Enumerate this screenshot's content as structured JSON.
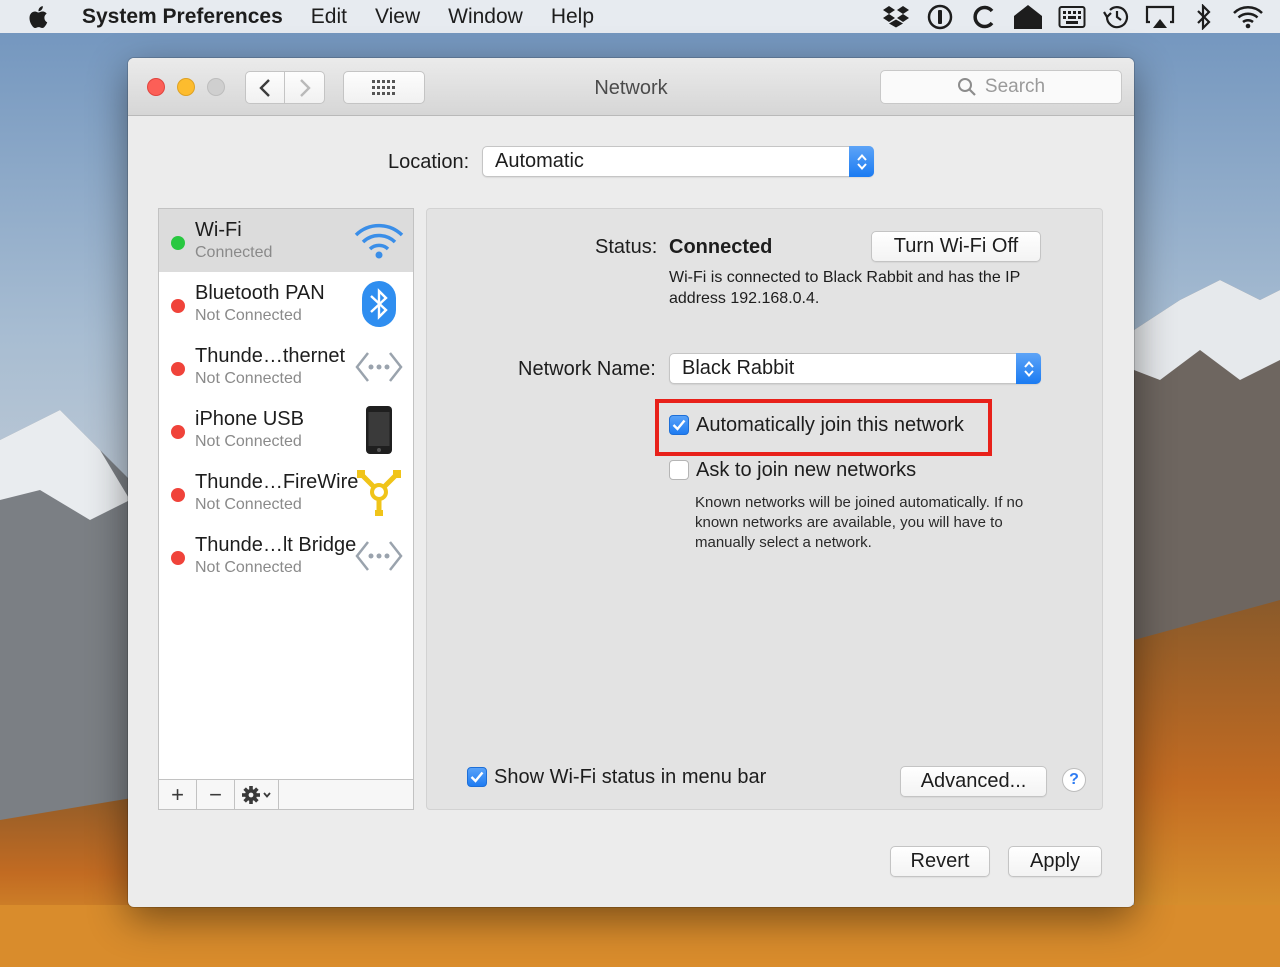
{
  "menubar": {
    "app_name": "System Preferences",
    "menus": [
      "Edit",
      "View",
      "Window",
      "Help"
    ],
    "status_icons": [
      "dropbox-icon",
      "1password-icon",
      "c-app-icon",
      "home-icon",
      "keyboard-viewer-icon",
      "time-machine-icon",
      "airplay-icon",
      "bluetooth-icon",
      "wifi-icon"
    ]
  },
  "window": {
    "title": "Network",
    "search_placeholder": "Search"
  },
  "location": {
    "label": "Location:",
    "value": "Automatic"
  },
  "services": [
    {
      "name": "Wi-Fi",
      "status": "Connected",
      "state_color": "#28c840",
      "icon": "wifi-icon",
      "selected": true
    },
    {
      "name": "Bluetooth PAN",
      "status": "Not Connected",
      "state_color": "#f0433a",
      "icon": "bluetooth-icon",
      "selected": false
    },
    {
      "name": "Thunde…thernet",
      "status": "Not Connected",
      "state_color": "#f0433a",
      "icon": "ethernet-icon",
      "selected": false
    },
    {
      "name": "iPhone USB",
      "status": "Not Connected",
      "state_color": "#f0433a",
      "icon": "iphone-icon",
      "selected": false
    },
    {
      "name": "Thunde…FireWire",
      "status": "Not Connected",
      "state_color": "#f0433a",
      "icon": "firewire-icon",
      "selected": false
    },
    {
      "name": "Thunde…lt Bridge",
      "status": "Not Connected",
      "state_color": "#f0433a",
      "icon": "bridge-icon",
      "selected": false
    }
  ],
  "list_toolbar": {
    "add": "+",
    "remove": "−"
  },
  "detail": {
    "status_label": "Status:",
    "status_value": "Connected",
    "turn_off_button": "Turn Wi-Fi Off",
    "status_description": "Wi-Fi is connected to Black Rabbit and has the IP address 192.168.0.4.",
    "network_name_label": "Network Name:",
    "network_name_value": "Black Rabbit",
    "auto_join_label": "Automatically join this network",
    "auto_join_checked": true,
    "ask_join_label": "Ask to join new networks",
    "ask_join_checked": false,
    "known_networks_description": "Known networks will be joined automatically. If no known networks are available, you will have to manually select a network.",
    "show_status_label": "Show Wi-Fi status in menu bar",
    "show_status_checked": true,
    "advanced_button": "Advanced...",
    "help_button": "?"
  },
  "footer": {
    "revert_button": "Revert",
    "apply_button": "Apply"
  },
  "colors": {
    "accent": "#1f7cf2",
    "highlight": "#e8211a",
    "connected": "#28c840",
    "not_connected": "#f0433a"
  }
}
